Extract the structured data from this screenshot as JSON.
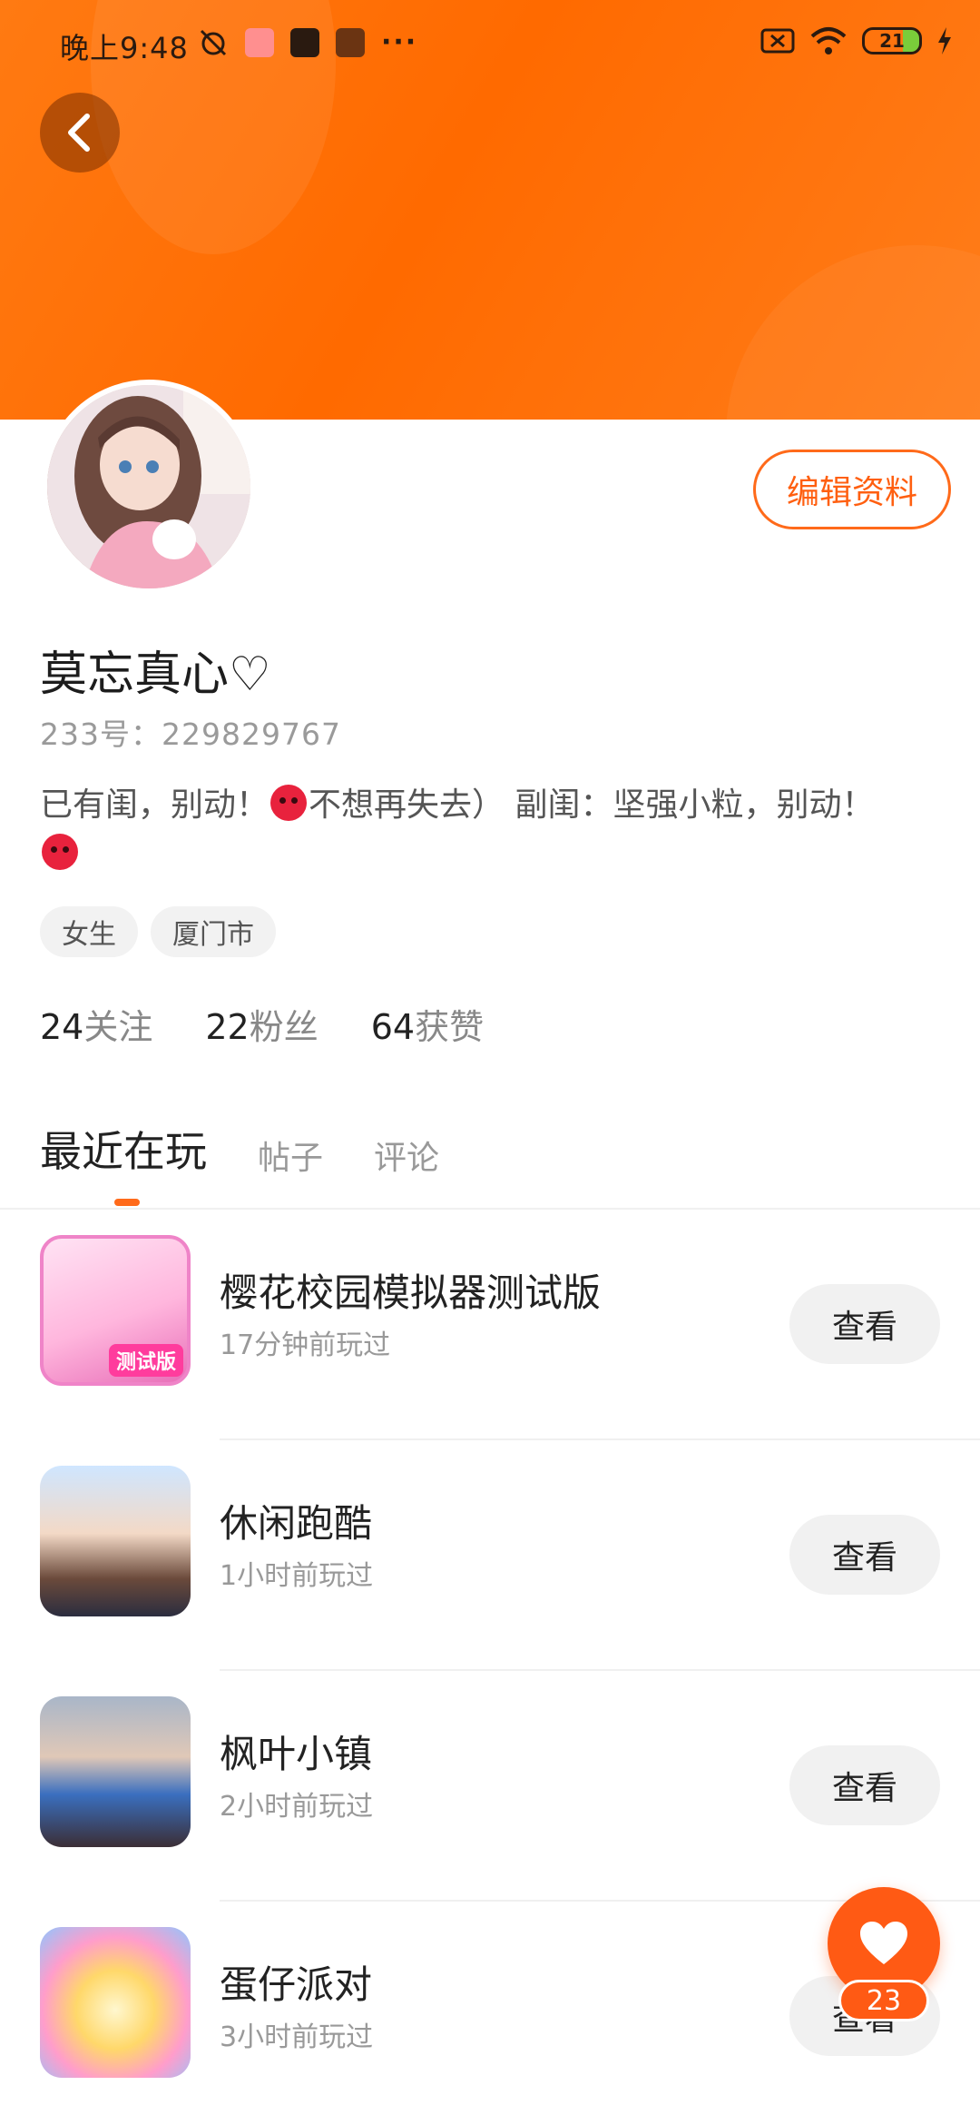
{
  "status_bar": {
    "time": "晚上9:48",
    "battery": "21"
  },
  "profile": {
    "nickname": "莫忘真心♡",
    "uid": "233号：229829767",
    "bio_part1": "已有闺，别动！",
    "bio_part2": "不想再失去）  副闺：坚强小粒，别动！",
    "edit_label": "编辑资料",
    "tags": [
      "女生",
      "厦门市"
    ]
  },
  "stats": {
    "following_num": "24",
    "following_label": "关注",
    "fans_num": "22",
    "fans_label": "粉丝",
    "likes_num": "64",
    "likes_label": "获赞"
  },
  "tabs": [
    "最近在玩",
    "帖子",
    "评论"
  ],
  "games": [
    {
      "title": "樱花校园模拟器测试版",
      "played": "17分钟前玩过",
      "button": "查看",
      "icon": "sakura-school-icon",
      "badge": "测试版"
    },
    {
      "title": "休闲跑酷",
      "played": "1小时前玩过",
      "button": "查看",
      "icon": "parkour-icon"
    },
    {
      "title": "枫叶小镇",
      "played": "2小时前玩过",
      "button": "查看",
      "icon": "maple-town-icon"
    },
    {
      "title": "蛋仔派对",
      "played": "3小时前玩过",
      "button": "查看",
      "icon": "eggy-party-icon"
    }
  ],
  "fab": {
    "count": "23",
    "icon": "heart-icon"
  },
  "colors": {
    "accent": "#ff6a1a",
    "banner": "#ff7a12"
  }
}
